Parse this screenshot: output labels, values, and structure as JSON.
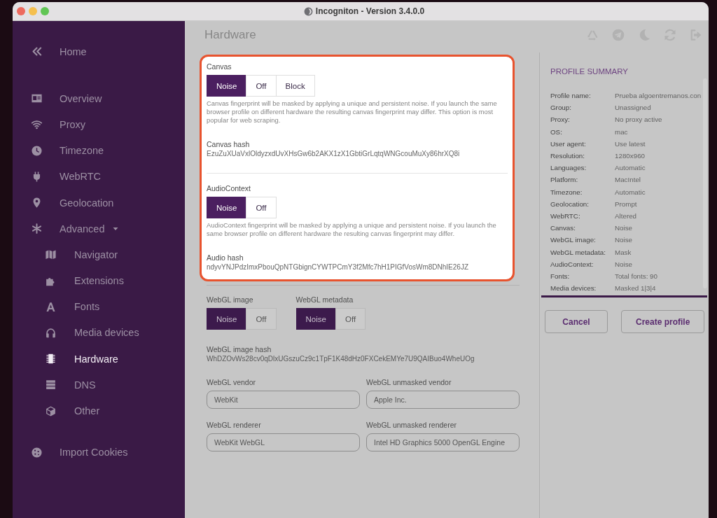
{
  "window": {
    "title": "Incogniton - Version 3.4.0.0"
  },
  "sidebar": {
    "back": {
      "label": "Home"
    },
    "items": [
      {
        "label": "Overview",
        "selected": false
      },
      {
        "label": "Proxy",
        "selected": false
      },
      {
        "label": "Timezone",
        "selected": false
      },
      {
        "label": "WebRTC",
        "selected": false
      },
      {
        "label": "Geolocation",
        "selected": false
      },
      {
        "label": "Advanced",
        "selected": false,
        "expanded": true,
        "children": [
          {
            "label": "Navigator",
            "selected": false
          },
          {
            "label": "Extensions",
            "selected": false
          },
          {
            "label": "Fonts",
            "selected": false
          },
          {
            "label": "Media devices",
            "selected": false
          },
          {
            "label": "Hardware",
            "selected": true
          },
          {
            "label": "DNS",
            "selected": false
          },
          {
            "label": "Other",
            "selected": false
          }
        ]
      }
    ],
    "footer": {
      "label": "Import Cookies"
    }
  },
  "content": {
    "title": "Hardware",
    "sections": [
      {
        "highlighted": true,
        "blocks": [
          {
            "rows": [
              {
                "fields": [
                  {
                    "kind": "choice",
                    "label": "Canvas",
                    "options": [
                      {
                        "label": "Noise",
                        "selected": true
                      },
                      {
                        "label": "Off",
                        "selected": false
                      },
                      {
                        "label": "Block",
                        "selected": false
                      }
                    ],
                    "description": "Canvas fingerprint will be masked by applying a unique and persistent noise. If you launch the same browser profile on different hardware the resulting canvas fingerprint may differ. This option is most popular for web scraping."
                  }
                ]
              },
              {
                "fields": [
                  {
                    "kind": "hash",
                    "label": "Canvas hash",
                    "value": "EzuZuXUaVxlOldyzxdUvXHsGw6b2AKX1zX1GbtiGrLqtqWNGcouMuXy86hrXQ8i"
                  }
                ]
              }
            ]
          },
          {
            "rows": [
              {
                "fields": [
                  {
                    "kind": "choice",
                    "label": "AudioContext",
                    "options": [
                      {
                        "label": "Noise",
                        "selected": true
                      },
                      {
                        "label": "Off",
                        "selected": false
                      }
                    ],
                    "description": "AudioContext fingerprint will be masked by applying a unique and persistent noise. If you launch the same browser profile on different hardware the resulting canvas fingerprint may differ."
                  }
                ]
              },
              {
                "fields": [
                  {
                    "kind": "hash",
                    "label": "Audio hash",
                    "value": "ndyvYNJPdzImxPbouQpNTGbignCYWTPCmY3f2Mfc7hH1PIGfVosWm8DNhIE26JZ"
                  }
                ]
              }
            ]
          }
        ]
      },
      {
        "highlighted": false,
        "blocks": [
          {
            "rows": [
              {
                "fields": [
                  {
                    "kind": "choice",
                    "label": "WebGL image",
                    "options": [
                      {
                        "label": "Noise",
                        "selected": true
                      },
                      {
                        "label": "Off",
                        "selected": false
                      }
                    ]
                  },
                  {
                    "kind": "choice",
                    "label": "WebGL metadata",
                    "options": [
                      {
                        "label": "Noise",
                        "selected": true
                      },
                      {
                        "label": "Off",
                        "selected": false
                      }
                    ]
                  }
                ]
              },
              {
                "fields": [
                  {
                    "kind": "hash",
                    "label": "WebGL image hash",
                    "value": "WhDZOvWs28cv0qDlxUGszuCz9c1TpF1K48dHz0FXCekEMYe7U9QAIBuo4WheUOg"
                  }
                ]
              },
              {
                "fields": [
                  {
                    "kind": "input",
                    "label": "WebGL vendor",
                    "value": "WebKit"
                  },
                  {
                    "kind": "input",
                    "label": "WebGL unmasked vendor",
                    "value": "Apple Inc."
                  }
                ]
              },
              {
                "fields": [
                  {
                    "kind": "input",
                    "label": "WebGL renderer",
                    "value": "WebKit WebGL"
                  },
                  {
                    "kind": "input",
                    "label": "WebGL unmasked renderer",
                    "value": "Intel HD Graphics 5000 OpenGL Engine"
                  }
                ]
              }
            ]
          }
        ]
      }
    ]
  },
  "summary": {
    "title": "PROFILE SUMMARY",
    "rows": [
      {
        "label": "Profile name:",
        "value": "Prueba algoentremanos.con"
      },
      {
        "label": "Group:",
        "value": "Unassigned"
      },
      {
        "label": "Proxy:",
        "value": "No proxy active"
      },
      {
        "label": "OS:",
        "value": "mac"
      },
      {
        "label": "User agent:",
        "value": "Use latest"
      },
      {
        "label": "Resolution:",
        "value": "1280x960"
      },
      {
        "label": "Languages:",
        "value": "Automatic"
      },
      {
        "label": "Platform:",
        "value": "MacIntel"
      },
      {
        "label": "Timezone:",
        "value": "Automatic"
      },
      {
        "label": "Geolocation:",
        "value": "Prompt"
      },
      {
        "label": "WebRTC:",
        "value": "Altered"
      },
      {
        "label": "Canvas:",
        "value": "Noise"
      },
      {
        "label": "WebGL image:",
        "value": "Noise"
      },
      {
        "label": "WebGL metadata:",
        "value": "Mask"
      },
      {
        "label": "AudioContext:",
        "value": "Noise"
      },
      {
        "label": "Fonts:",
        "value": "Total fonts: 90"
      },
      {
        "label": "Media devices:",
        "value": "Masked 1|3|4"
      }
    ],
    "buttons": [
      "Cancel",
      "Create profile"
    ]
  }
}
